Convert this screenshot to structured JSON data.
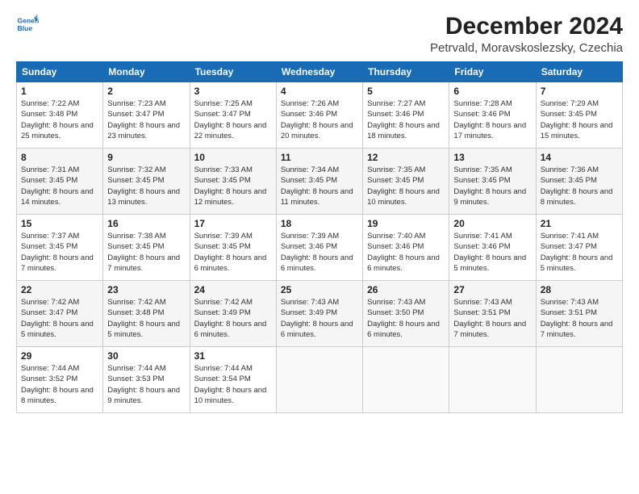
{
  "logo": {
    "line1": "General",
    "line2": "Blue"
  },
  "title": "December 2024",
  "location": "Petrvald, Moravskoslezsky, Czechia",
  "days_of_week": [
    "Sunday",
    "Monday",
    "Tuesday",
    "Wednesday",
    "Thursday",
    "Friday",
    "Saturday"
  ],
  "weeks": [
    [
      {
        "day": "1",
        "sunrise": "7:22 AM",
        "sunset": "3:48 PM",
        "daylight": "8 hours and 25 minutes."
      },
      {
        "day": "2",
        "sunrise": "7:23 AM",
        "sunset": "3:47 PM",
        "daylight": "8 hours and 23 minutes."
      },
      {
        "day": "3",
        "sunrise": "7:25 AM",
        "sunset": "3:47 PM",
        "daylight": "8 hours and 22 minutes."
      },
      {
        "day": "4",
        "sunrise": "7:26 AM",
        "sunset": "3:46 PM",
        "daylight": "8 hours and 20 minutes."
      },
      {
        "day": "5",
        "sunrise": "7:27 AM",
        "sunset": "3:46 PM",
        "daylight": "8 hours and 18 minutes."
      },
      {
        "day": "6",
        "sunrise": "7:28 AM",
        "sunset": "3:46 PM",
        "daylight": "8 hours and 17 minutes."
      },
      {
        "day": "7",
        "sunrise": "7:29 AM",
        "sunset": "3:45 PM",
        "daylight": "8 hours and 15 minutes."
      }
    ],
    [
      {
        "day": "8",
        "sunrise": "7:31 AM",
        "sunset": "3:45 PM",
        "daylight": "8 hours and 14 minutes."
      },
      {
        "day": "9",
        "sunrise": "7:32 AM",
        "sunset": "3:45 PM",
        "daylight": "8 hours and 13 minutes."
      },
      {
        "day": "10",
        "sunrise": "7:33 AM",
        "sunset": "3:45 PM",
        "daylight": "8 hours and 12 minutes."
      },
      {
        "day": "11",
        "sunrise": "7:34 AM",
        "sunset": "3:45 PM",
        "daylight": "8 hours and 11 minutes."
      },
      {
        "day": "12",
        "sunrise": "7:35 AM",
        "sunset": "3:45 PM",
        "daylight": "8 hours and 10 minutes."
      },
      {
        "day": "13",
        "sunrise": "7:35 AM",
        "sunset": "3:45 PM",
        "daylight": "8 hours and 9 minutes."
      },
      {
        "day": "14",
        "sunrise": "7:36 AM",
        "sunset": "3:45 PM",
        "daylight": "8 hours and 8 minutes."
      }
    ],
    [
      {
        "day": "15",
        "sunrise": "7:37 AM",
        "sunset": "3:45 PM",
        "daylight": "8 hours and 7 minutes."
      },
      {
        "day": "16",
        "sunrise": "7:38 AM",
        "sunset": "3:45 PM",
        "daylight": "8 hours and 7 minutes."
      },
      {
        "day": "17",
        "sunrise": "7:39 AM",
        "sunset": "3:45 PM",
        "daylight": "8 hours and 6 minutes."
      },
      {
        "day": "18",
        "sunrise": "7:39 AM",
        "sunset": "3:46 PM",
        "daylight": "8 hours and 6 minutes."
      },
      {
        "day": "19",
        "sunrise": "7:40 AM",
        "sunset": "3:46 PM",
        "daylight": "8 hours and 6 minutes."
      },
      {
        "day": "20",
        "sunrise": "7:41 AM",
        "sunset": "3:46 PM",
        "daylight": "8 hours and 5 minutes."
      },
      {
        "day": "21",
        "sunrise": "7:41 AM",
        "sunset": "3:47 PM",
        "daylight": "8 hours and 5 minutes."
      }
    ],
    [
      {
        "day": "22",
        "sunrise": "7:42 AM",
        "sunset": "3:47 PM",
        "daylight": "8 hours and 5 minutes."
      },
      {
        "day": "23",
        "sunrise": "7:42 AM",
        "sunset": "3:48 PM",
        "daylight": "8 hours and 5 minutes."
      },
      {
        "day": "24",
        "sunrise": "7:42 AM",
        "sunset": "3:49 PM",
        "daylight": "8 hours and 6 minutes."
      },
      {
        "day": "25",
        "sunrise": "7:43 AM",
        "sunset": "3:49 PM",
        "daylight": "8 hours and 6 minutes."
      },
      {
        "day": "26",
        "sunrise": "7:43 AM",
        "sunset": "3:50 PM",
        "daylight": "8 hours and 6 minutes."
      },
      {
        "day": "27",
        "sunrise": "7:43 AM",
        "sunset": "3:51 PM",
        "daylight": "8 hours and 7 minutes."
      },
      {
        "day": "28",
        "sunrise": "7:43 AM",
        "sunset": "3:51 PM",
        "daylight": "8 hours and 7 minutes."
      }
    ],
    [
      {
        "day": "29",
        "sunrise": "7:44 AM",
        "sunset": "3:52 PM",
        "daylight": "8 hours and 8 minutes."
      },
      {
        "day": "30",
        "sunrise": "7:44 AM",
        "sunset": "3:53 PM",
        "daylight": "8 hours and 9 minutes."
      },
      {
        "day": "31",
        "sunrise": "7:44 AM",
        "sunset": "3:54 PM",
        "daylight": "8 hours and 10 minutes."
      },
      null,
      null,
      null,
      null
    ]
  ],
  "labels": {
    "sunrise": "Sunrise:",
    "sunset": "Sunset:",
    "daylight": "Daylight:"
  }
}
